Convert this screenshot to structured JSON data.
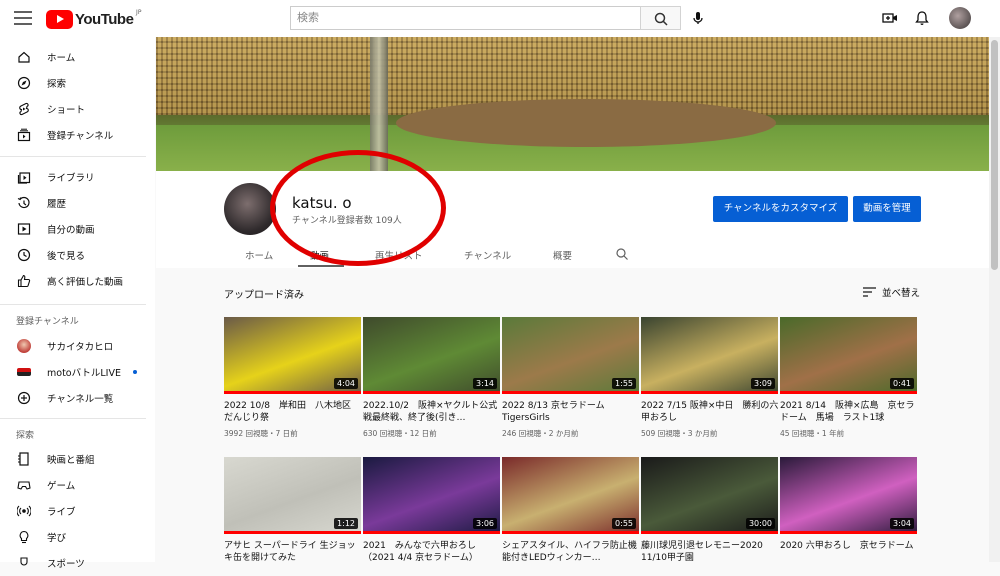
{
  "topbar": {
    "logo_text": "YouTube",
    "logo_region": "JP",
    "search_placeholder": "検索"
  },
  "sidebar": {
    "main": [
      {
        "label": "ホーム",
        "icon": "home-icon"
      },
      {
        "label": "探索",
        "icon": "compass-icon"
      },
      {
        "label": "ショート",
        "icon": "shorts-icon"
      },
      {
        "label": "登録チャンネル",
        "icon": "subscriptions-icon"
      }
    ],
    "library": [
      {
        "label": "ライブラリ",
        "icon": "library-icon"
      },
      {
        "label": "履歴",
        "icon": "history-icon"
      },
      {
        "label": "自分の動画",
        "icon": "your-videos-icon"
      },
      {
        "label": "後で見る",
        "icon": "watch-later-icon"
      },
      {
        "label": "高く評価した動画",
        "icon": "like-icon"
      }
    ],
    "subscriptions_heading": "登録チャンネル",
    "subscriptions": [
      {
        "label": "サカイタカヒロ",
        "color": "#c0403a"
      },
      {
        "label": "motoバトルLIVE",
        "color": "#d01010",
        "live": true
      },
      {
        "label": "チャンネル一覧",
        "icon": "add-circle-icon"
      }
    ],
    "explore_heading": "探索",
    "explore": [
      {
        "label": "映画と番組",
        "icon": "film-icon"
      },
      {
        "label": "ゲーム",
        "icon": "gaming-icon"
      },
      {
        "label": "ライブ",
        "icon": "live-icon"
      },
      {
        "label": "学び",
        "icon": "learning-icon"
      },
      {
        "label": "スポーツ",
        "icon": "sports-icon"
      }
    ]
  },
  "channel": {
    "name": "katsu. o",
    "subscribers": "チャンネル登録者数 109人",
    "customize_label": "チャンネルをカスタマイズ",
    "manage_label": "動画を管理",
    "tabs": [
      "ホーム",
      "動画",
      "再生リスト",
      "チャンネル",
      "概要"
    ],
    "active_tab": "動画"
  },
  "section": {
    "title": "アップロード済み",
    "sort_label": "並べ替え"
  },
  "videos_row1": [
    {
      "title": "2022 10/8　岸和田　八木地区　だんじり祭",
      "meta": "3992 回視聴・7 日前",
      "duration": "4:04",
      "progress": 1.0,
      "bg": "#6a5a48",
      "accent": "#e6d21a"
    },
    {
      "title": "2022.10/2　阪神×ヤクルト公式戦最終戦、終了後(引き…",
      "meta": "630 回視聴・12 日前",
      "duration": "3:14",
      "progress": 1.0,
      "bg": "#3f4a2c",
      "accent": "#5f8a35"
    },
    {
      "title": "2022 8/13 京セラドーム TigersGirls",
      "meta": "246 回視聴・2 か月前",
      "duration": "1:55",
      "progress": 1.0,
      "bg": "#5a7a3a",
      "accent": "#9c7a4a"
    },
    {
      "title": "2022 7/15 阪神×中日　勝利の六甲おろし",
      "meta": "509 回視聴・3 か月前",
      "duration": "3:09",
      "progress": 1.0,
      "bg": "#3a4430",
      "accent": "#c8b060"
    },
    {
      "title": "2021 8/14　阪神×広島　京セラドーム　馬場　ラスト1球",
      "meta": "45 回視聴・1 年前",
      "duration": "0:41",
      "progress": 1.0,
      "bg": "#4a6a2a",
      "accent": "#a07048"
    }
  ],
  "videos_row2": [
    {
      "title": "アサヒ スーパードライ 生ジョッキ缶を開けてみた",
      "meta": "",
      "duration": "1:12",
      "progress": 1.0,
      "bg": "#d8d8d0",
      "accent": "#c0c0b8"
    },
    {
      "title": "2021　みんなで六甲おろし（2021 4/4 京セラドーム）",
      "meta": "",
      "duration": "3:06",
      "progress": 1.0,
      "bg": "#1a1a40",
      "accent": "#7a3a9a"
    },
    {
      "title": "シェアスタイル、ハイフラ防止機能付きLEDウィンカー…",
      "meta": "",
      "duration": "0:55",
      "progress": 1.0,
      "bg": "#7a2a2a",
      "accent": "#c8b070"
    },
    {
      "title": "藤川球児引退セレモニー2020 11/10甲子園",
      "meta": "",
      "duration": "30:00",
      "progress": 1.0,
      "bg": "#1a1a1a",
      "accent": "#4a5a3a"
    },
    {
      "title": "2020 六甲おろし　京セラドーム",
      "meta": "",
      "duration": "3:04",
      "progress": 1.0,
      "bg": "#2a1a3a",
      "accent": "#d060c0"
    }
  ]
}
